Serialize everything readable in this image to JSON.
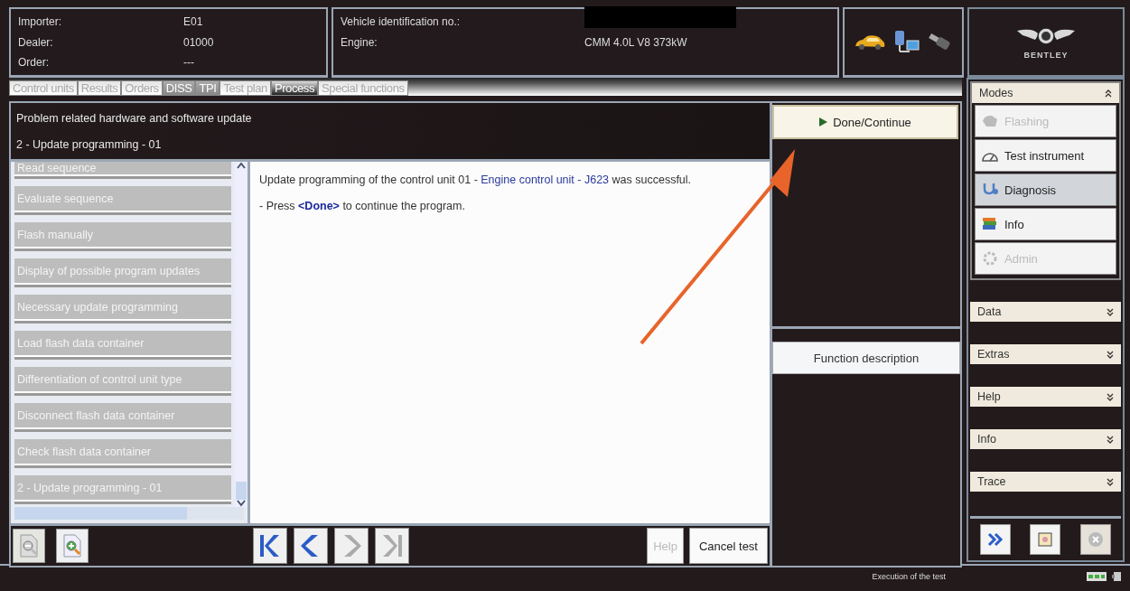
{
  "header": {
    "fields": [
      {
        "label": "Importer:",
        "value": "E01"
      },
      {
        "label": "Dealer:",
        "value": "01000"
      },
      {
        "label": "Order:",
        "value": "---"
      }
    ],
    "vehicle": [
      {
        "label": "Vehicle identification no.:",
        "redacted": true
      },
      {
        "label": "Engine:",
        "redacted": false,
        "value": "CMM 4.0L V8  373kW"
      }
    ],
    "logo_text": "BENTLEY"
  },
  "tabs": [
    {
      "label": "Control units",
      "selected": false,
      "disabled": true
    },
    {
      "label": "Results",
      "selected": false,
      "disabled": true
    },
    {
      "label": "Orders",
      "selected": false,
      "disabled": true
    },
    {
      "label": "DISS",
      "selected": false,
      "disabled": false
    },
    {
      "label": "TPI",
      "selected": false,
      "disabled": false
    },
    {
      "label": "Test plan",
      "selected": false,
      "disabled": true
    },
    {
      "label": "Process",
      "selected": true,
      "disabled": false
    },
    {
      "label": "Special functions",
      "selected": false,
      "disabled": true
    }
  ],
  "process": {
    "title": "Problem related hardware and software update",
    "step": "2 - Update programming - 01",
    "steps": [
      "Read sequence",
      "Evaluate sequence",
      "Flash manually",
      "Display of possible program updates",
      "Necessary update programming",
      "Load flash data container",
      "Differentiation of control unit type",
      "Disconnect flash data container",
      "Check flash data container",
      "2 - Update programming - 01"
    ],
    "message": [
      [
        {
          "text": "Update programming of the control unit 01 - ",
          "kind": "text"
        },
        {
          "text": "Engine control unit - J623",
          "kind": "link"
        },
        {
          "text": "  was successful.",
          "kind": "text"
        }
      ],
      [
        {
          "text": "- Press ",
          "kind": "text"
        },
        {
          "text": "<Done>",
          "kind": "key"
        },
        {
          "text": " to continue the program.",
          "kind": "text"
        }
      ]
    ],
    "zoom_buttons": [
      {
        "kind": "zoom-out",
        "disabled": true
      },
      {
        "kind": "zoom-in",
        "disabled": false
      }
    ],
    "nav_buttons": [
      {
        "kind": "first",
        "disabled": false
      },
      {
        "kind": "previous",
        "disabled": false
      },
      {
        "kind": "next",
        "disabled": true
      },
      {
        "kind": "last",
        "disabled": true
      }
    ],
    "help_button": {
      "label": "Help",
      "disabled": true
    },
    "cancel_button": {
      "label": "Cancel test",
      "disabled": false
    },
    "done_button": {
      "label": "Done/Continue"
    },
    "function_button": {
      "label": "Function description"
    }
  },
  "sidebar": {
    "modes": {
      "title": "Modes",
      "expanded": true,
      "items": [
        {
          "label": "Flashing",
          "kind": "flash",
          "disabled": true,
          "selected": false
        },
        {
          "label": "Test instrument",
          "kind": "gauge",
          "disabled": false,
          "selected": false
        },
        {
          "label": "Diagnosis",
          "kind": "stethoscope",
          "disabled": false,
          "selected": true
        },
        {
          "label": "Info",
          "kind": "books",
          "disabled": false,
          "selected": false
        },
        {
          "label": "Admin",
          "kind": "gear",
          "disabled": true,
          "selected": false
        }
      ]
    },
    "sections": [
      {
        "title": "Data",
        "expanded": false
      },
      {
        "title": "Extras",
        "expanded": false
      },
      {
        "title": "Help",
        "expanded": false
      },
      {
        "title": "Info",
        "expanded": false
      },
      {
        "title": "Trace",
        "expanded": false
      }
    ],
    "buttons": [
      {
        "kind": "forward",
        "disabled": false
      },
      {
        "kind": "fit",
        "disabled": false
      },
      {
        "kind": "close",
        "disabled": true
      }
    ]
  },
  "status_bar": {
    "text": "Execution of the test"
  }
}
